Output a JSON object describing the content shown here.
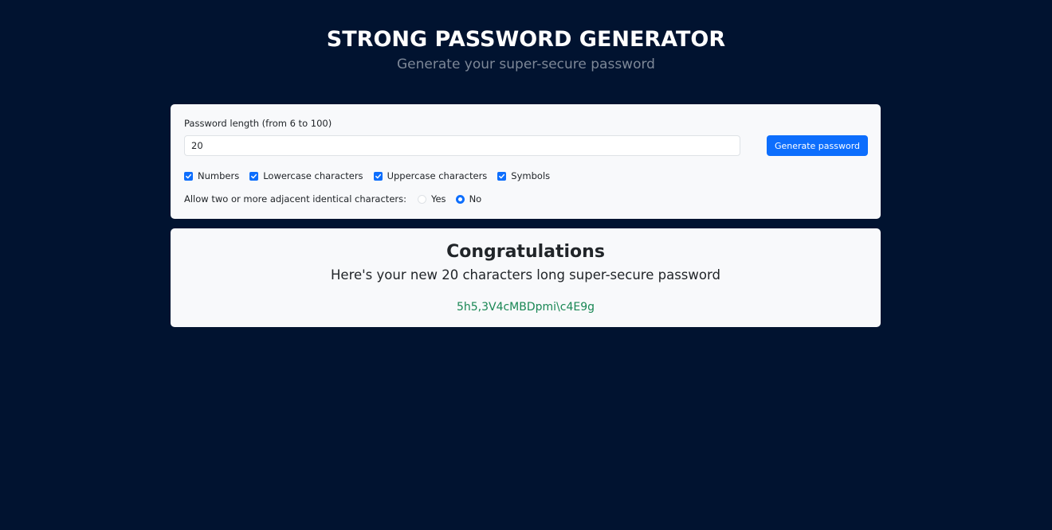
{
  "header": {
    "title": "STRONG PASSWORD GENERATOR",
    "subtitle": "Generate your super-secure password"
  },
  "form": {
    "length_label": "Password length (from 6 to 100)",
    "length_value": "20",
    "generate_label": "Generate password",
    "checkboxes": [
      {
        "label": "Numbers",
        "checked": true
      },
      {
        "label": "Lowercase characters",
        "checked": true
      },
      {
        "label": "Uppercase characters",
        "checked": true
      },
      {
        "label": "Symbols",
        "checked": true
      }
    ],
    "adjacent_label": "Allow two or more adjacent identical characters:",
    "radios": [
      {
        "label": "Yes",
        "checked": false
      },
      {
        "label": "No",
        "checked": true
      }
    ]
  },
  "result": {
    "heading": "Congratulations",
    "message": "Here's your new 20 characters long super-secure password",
    "password": "5h5,3V4cMBDpmi\\c4E9g"
  },
  "colors": {
    "background": "#011330",
    "card": "#f8f9fb",
    "primary": "#0d6efd",
    "password": "#198754"
  }
}
